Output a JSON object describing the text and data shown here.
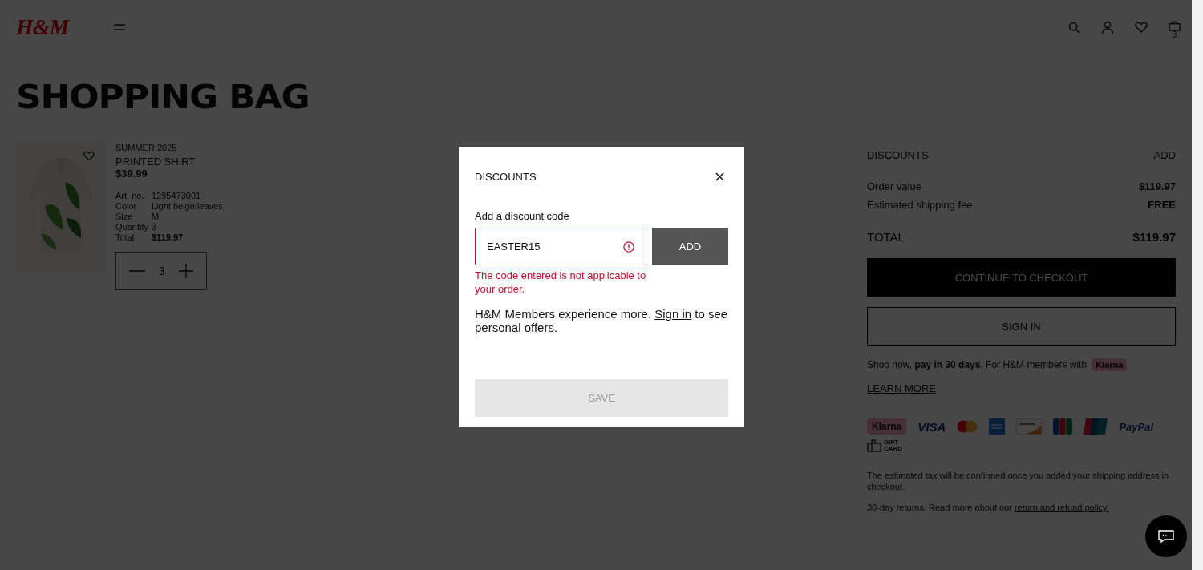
{
  "header": {
    "logo": "H&M",
    "cart_count": "3"
  },
  "title": "SHOPPING BAG",
  "item": {
    "collection": "SUMMER 2025",
    "name": "PRINTED SHIRT",
    "price": "$39.99",
    "favorite": false,
    "quantity": "3",
    "details": [
      {
        "label": "Art. no.",
        "value": "1295473001",
        "kind": "plain"
      },
      {
        "label": "Color",
        "value": "Light beige/leaves",
        "kind": "plain"
      },
      {
        "label": "Size",
        "value": "M",
        "kind": "plain"
      },
      {
        "label": "Quantity",
        "value": "3",
        "kind": "plain"
      },
      {
        "label": "Total",
        "value": "$119.97",
        "kind": "total"
      }
    ]
  },
  "summary": {
    "discounts_label": "DISCOUNTS",
    "discounts_link": "ADD",
    "lines": [
      {
        "label": "Order value",
        "value": "$119.97"
      },
      {
        "label": "Estimated shipping fee",
        "value": "FREE"
      }
    ],
    "total_label": "TOTAL",
    "total_value": "$119.97",
    "checkout_button": "CONTINUE TO CHECKOUT",
    "sign_in_button": "SIGN IN",
    "klarna_text": "Shop now, **pay in 30 days**. For H&M members with",
    "klarna_badge": "Klarna",
    "learn_more": "LEARN MORE",
    "payments": [
      {
        "kind": "klarna",
        "label": "Klarna"
      },
      {
        "kind": "visa",
        "label": "VISA"
      },
      {
        "kind": "mastercard"
      },
      {
        "kind": "amex"
      },
      {
        "kind": "discover"
      },
      {
        "kind": "jcb"
      },
      {
        "kind": "unionpay"
      },
      {
        "kind": "paypal",
        "label": "PayPal"
      },
      {
        "kind": "giftcard",
        "label": "GIFT CARD"
      }
    ],
    "tax_note": "The estimated tax will be confirmed once you added your shipping address in checkout.",
    "returns_text": "30-day returns. Read more about our",
    "returns_link": "return and refund policy."
  },
  "modal": {
    "title": "DISCOUNTS",
    "field_label": "Add a discount code",
    "code": "EASTER15",
    "error": true,
    "error_text": "The code entered is not applicable to your order.",
    "add_button": "ADD",
    "members_text": "H&M Members experience more.",
    "members_link": "Sign in",
    "members_text_end": "to see personal offers.",
    "save_button": "SAVE",
    "save_disabled": true
  }
}
